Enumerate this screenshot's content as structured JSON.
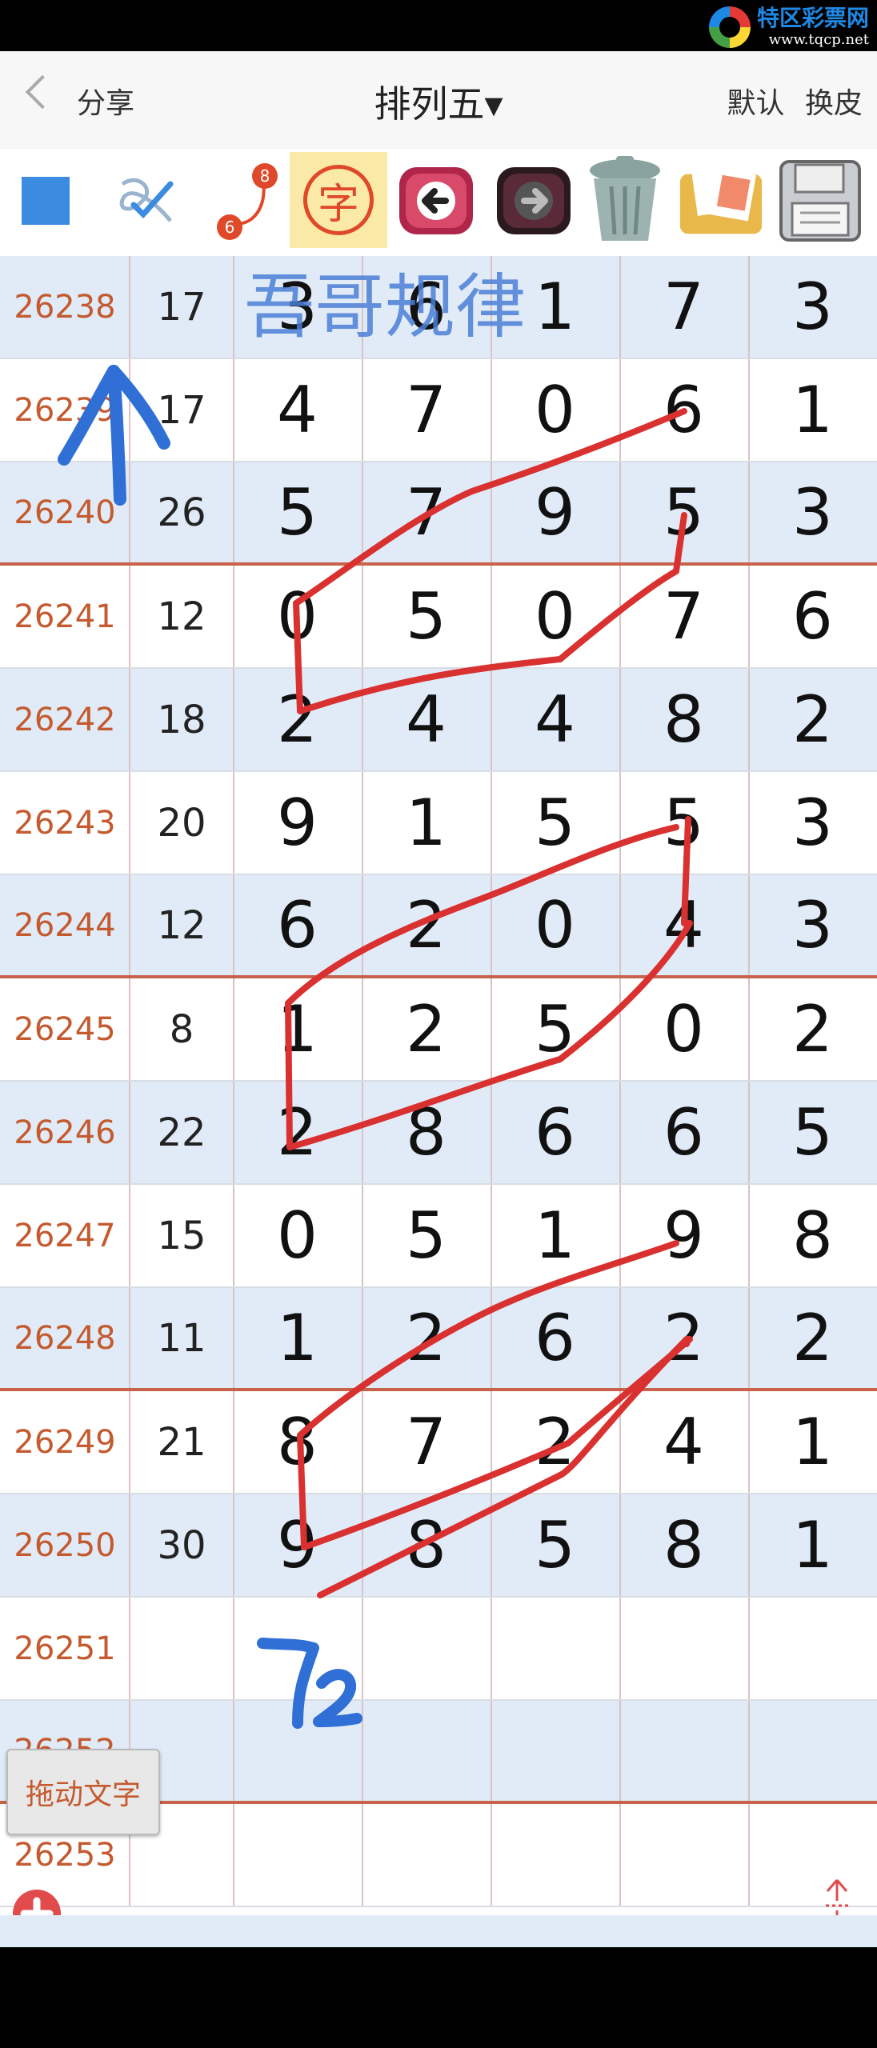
{
  "watermark": {
    "title": "特区彩票网",
    "url": "www.tqcp.net"
  },
  "nav": {
    "back_label": "分享",
    "title": "排列五▾",
    "default_label": "默认",
    "skin_label": "换皮"
  },
  "toolbar": {
    "badge_8": "8",
    "badge_6": "6",
    "char_label": "字",
    "icons": [
      "square-tool-icon",
      "pen-check-icon",
      "numbered-path-icon",
      "char-icon",
      "undo-icon",
      "redo-icon",
      "trash-icon",
      "photos-icon",
      "save-icon"
    ]
  },
  "annotation": {
    "title": "吾哥规律",
    "note": "72"
  },
  "rows": [
    {
      "issue": "26238",
      "sum": "17",
      "d": [
        "3",
        "6",
        "1",
        "7",
        "3"
      ]
    },
    {
      "issue": "26239",
      "sum": "17",
      "d": [
        "4",
        "7",
        "0",
        "6",
        "1"
      ]
    },
    {
      "issue": "26240",
      "sum": "26",
      "d": [
        "5",
        "7",
        "9",
        "5",
        "3"
      ]
    },
    {
      "issue": "26241",
      "sum": "12",
      "d": [
        "0",
        "5",
        "0",
        "7",
        "6"
      ]
    },
    {
      "issue": "26242",
      "sum": "18",
      "d": [
        "2",
        "4",
        "4",
        "8",
        "2"
      ]
    },
    {
      "issue": "26243",
      "sum": "20",
      "d": [
        "9",
        "1",
        "5",
        "5",
        "3"
      ]
    },
    {
      "issue": "26244",
      "sum": "12",
      "d": [
        "6",
        "2",
        "0",
        "4",
        "3"
      ]
    },
    {
      "issue": "26245",
      "sum": "8",
      "d": [
        "1",
        "2",
        "5",
        "0",
        "2"
      ]
    },
    {
      "issue": "26246",
      "sum": "22",
      "d": [
        "2",
        "8",
        "6",
        "6",
        "5"
      ]
    },
    {
      "issue": "26247",
      "sum": "15",
      "d": [
        "0",
        "5",
        "1",
        "9",
        "8"
      ]
    },
    {
      "issue": "26248",
      "sum": "11",
      "d": [
        "1",
        "2",
        "6",
        "2",
        "2"
      ]
    },
    {
      "issue": "26249",
      "sum": "21",
      "d": [
        "8",
        "7",
        "2",
        "4",
        "1"
      ]
    },
    {
      "issue": "26250",
      "sum": "30",
      "d": [
        "9",
        "8",
        "5",
        "8",
        "1"
      ]
    },
    {
      "issue": "26251",
      "sum": "",
      "d": [
        "",
        "",
        "",
        "",
        ""
      ]
    },
    {
      "issue": "26252",
      "sum": "",
      "d": [
        "",
        "",
        "",
        "",
        ""
      ]
    },
    {
      "issue": "26253",
      "sum": "",
      "d": [
        "",
        "",
        "",
        "",
        ""
      ]
    }
  ],
  "drag_button_label": "拖动文字",
  "colors": {
    "issue_text": "#c45a2e",
    "row_alt": "#e1ebf8",
    "separator": "#c8624a",
    "ink_red": "#d93030",
    "ink_blue": "#2f6fd6"
  }
}
